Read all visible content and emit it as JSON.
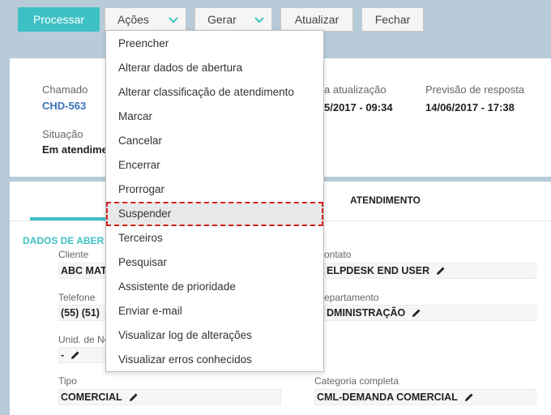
{
  "toolbar": {
    "process": "Processar",
    "actions": "Ações",
    "generate": "Gerar",
    "update": "Atualizar",
    "close": "Fechar"
  },
  "ticket": {
    "chamado_label": "Chamado",
    "chamado_value": "CHD-563",
    "last_update_label": "a atualização",
    "last_update_value": "5/2017 - 09:34",
    "forecast_label": "Previsão de resposta",
    "forecast_value": "14/06/2017 - 17:38",
    "situacao_label": "Situação",
    "situacao_value": "Em atendime"
  },
  "tabs": {
    "atendimento": "ATENDIMENTO"
  },
  "section": {
    "title": "DADOS DE ABER"
  },
  "fields": {
    "cliente_label": "Cliente",
    "cliente_value": "ABC MAT",
    "contato_label": "ontato",
    "contato_value": "ELPDESK END USER",
    "telefone_label": "Telefone",
    "telefone_value": "(55) (51)",
    "departamento_label": "epartamento",
    "departamento_value": "DMINISTRAÇÃO",
    "unid_label": "Unid. de Ne",
    "unid_value": "-",
    "tipo_label": "Tipo",
    "tipo_value": "COMERCIAL",
    "categoria_label": "Categoria completa",
    "categoria_value": "CML-DEMANDA COMERCIAL"
  },
  "menu": {
    "items": [
      "Preencher",
      "Alterar dados de abertura",
      "Alterar classificação de atendimento",
      "Marcar",
      "Cancelar",
      "Encerrar",
      "Prorrogar",
      "Suspender",
      "Terceiros",
      "Pesquisar",
      "Assistente de prioridade",
      "Enviar e-mail",
      "Visualizar log de alterações",
      "Visualizar erros conhecidos"
    ],
    "highlighted_index": 7
  },
  "colors": {
    "accent": "#3ec1c4",
    "link": "#3a73b9",
    "background": "#b7cbd8",
    "highlight_outline": "#d92020"
  }
}
